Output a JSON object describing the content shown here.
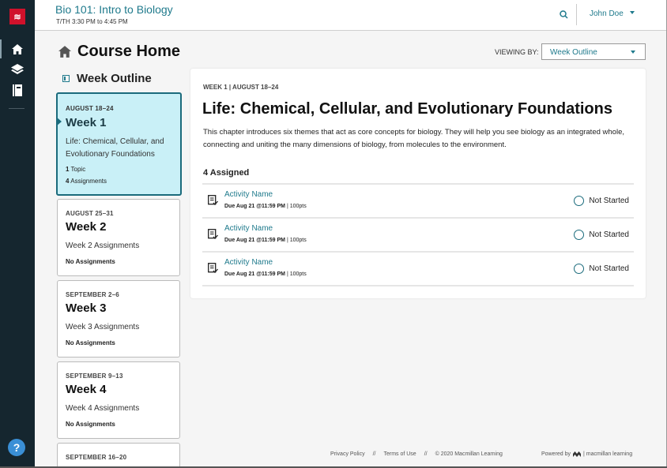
{
  "sidebar": {
    "logo": "≋",
    "nav": [
      {
        "icon": "home-icon"
      },
      {
        "icon": "layers-icon"
      },
      {
        "icon": "notebook-icon"
      }
    ],
    "help_label": "?"
  },
  "header": {
    "course_title": "Bio 101: Intro to Biology",
    "course_time": "T/TH 3:30 PM to 4:45 PM",
    "user_name": "John Doe"
  },
  "page": {
    "title": "Course Home",
    "viewing_by_label": "VIEWING BY:",
    "viewing_by_value": "Week Outline"
  },
  "outline": {
    "title": "Week Outline",
    "weeks": [
      {
        "date": "AUGUST 18–24",
        "name": "Week 1",
        "desc": "Life: Chemical, Cellular, and Evolutionary Foundations",
        "topics_count": "1",
        "topics_label": "Topic",
        "assign_count": "4",
        "assign_label": "Assignments",
        "active": true
      },
      {
        "date": "AUGUST 25–31",
        "name": "Week 2",
        "desc": "Week 2 Assignments",
        "meta": "No Assignments"
      },
      {
        "date": "SEPTEMBER 2–6",
        "name": "Week 3",
        "desc": "Week 3 Assignments",
        "meta": "No Assignments"
      },
      {
        "date": "SEPTEMBER 9–13",
        "name": "Week 4",
        "desc": "Week 4 Assignments",
        "meta": "No Assignments"
      },
      {
        "date": "SEPTEMBER 16–20"
      }
    ]
  },
  "main": {
    "eyebrow": "WEEK 1 | AUGUST 18–24",
    "title": "Life: Chemical, Cellular, and Evolutionary Foundations",
    "description": "This chapter introduces six themes that act as core concepts for biology. They will help you see biology as an integrated whole,  connecting and uniting the many dimensions of biology, from molecules to the environment.",
    "assigned_label": "4 Assigned",
    "activities": [
      {
        "name": "Activity Name",
        "due": "Due Aug 21 @11:59 PM",
        "points": "| 100pts",
        "status": "Not Started"
      },
      {
        "name": "Activity Name",
        "due": "Due Aug 21 @11:59 PM",
        "points": "| 100pts",
        "status": "Not Started"
      },
      {
        "name": "Activity Name",
        "due": "Due Aug 21 @11:59 PM",
        "points": "| 100pts",
        "status": "Not Started"
      }
    ]
  },
  "footer": {
    "privacy": "Privacy Policy",
    "sep1": "//",
    "terms": "Terms of Use",
    "sep2": "//",
    "copyright": "© 2020 Macmillan Learning",
    "powered_by": "Powered by",
    "brand": "| macmillan learning"
  },
  "colors": {
    "accent": "#1f7a8c",
    "sidebar_bg": "#15262f",
    "active_week_bg": "#c9f0f7",
    "brand_red": "#d0112b"
  }
}
